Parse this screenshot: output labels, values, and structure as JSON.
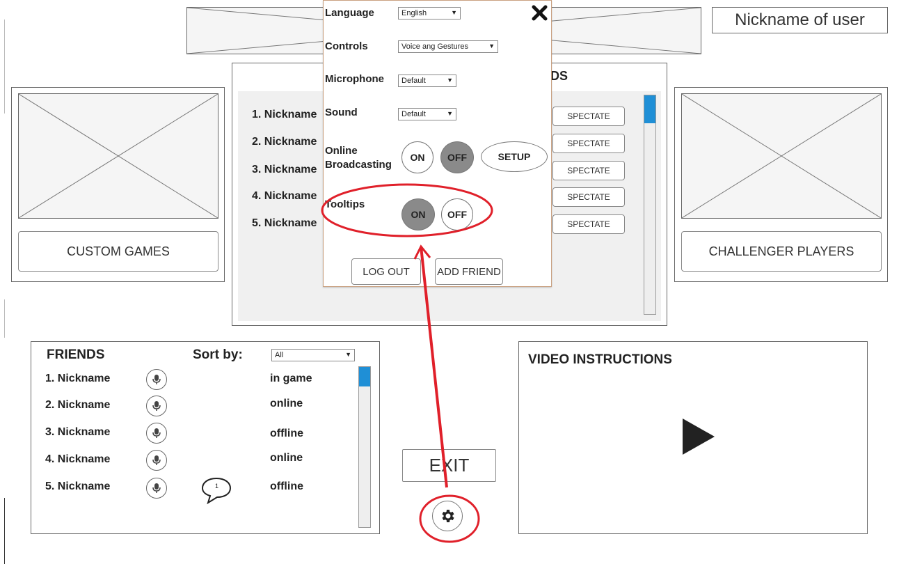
{
  "header": {
    "user_nickname": "Nickname of user"
  },
  "left_panel": {
    "button_label": "CUSTOM GAMES"
  },
  "right_panel": {
    "button_label": "CHALLENGER PLAYERS"
  },
  "center_panel": {
    "title_visible": "DS",
    "players": [
      {
        "label": "1. Nickname",
        "action": "SPECTATE"
      },
      {
        "label": "2. Nickname",
        "action": "SPECTATE"
      },
      {
        "label": "3. Nickname",
        "action": "SPECTATE"
      },
      {
        "label": "4. Nickname",
        "action": "SPECTATE"
      },
      {
        "label": "5. Nickname",
        "action": "SPECTATE"
      }
    ]
  },
  "settings": {
    "language_label": "Language",
    "language_value": "English",
    "controls_label": "Controls",
    "controls_value": "Voice ang Gestures",
    "microphone_label": "Microphone",
    "microphone_value": "Default",
    "sound_label": "Sound",
    "sound_value": "Default",
    "broadcast_label_1": "Online",
    "broadcast_label_2": "Broadcasting",
    "broadcast_on": "ON",
    "broadcast_off": "OFF",
    "broadcast_setup": "SETUP",
    "tooltips_label": "Tooltips",
    "tooltips_on": "ON",
    "tooltips_off": "OFF",
    "logout": "LOG OUT",
    "add_friend": "ADD FRIEND",
    "close_icon": "close-icon"
  },
  "friends": {
    "title": "FRIENDS",
    "sort_label": "Sort by:",
    "sort_value": "All",
    "list": [
      {
        "name": "1. Nickname",
        "status": "in game"
      },
      {
        "name": "2. Nickname",
        "status": "online"
      },
      {
        "name": "3. Nickname",
        "status": "offline"
      },
      {
        "name": "4. Nickname",
        "status": "online"
      },
      {
        "name": "5. Nickname",
        "status": "offline"
      }
    ],
    "message_count": "1"
  },
  "exit_label": "EXIT",
  "video": {
    "title": "VIDEO INSTRUCTIONS"
  },
  "annotation_color": "#e0202a",
  "accent_color": "#1f8fd6"
}
